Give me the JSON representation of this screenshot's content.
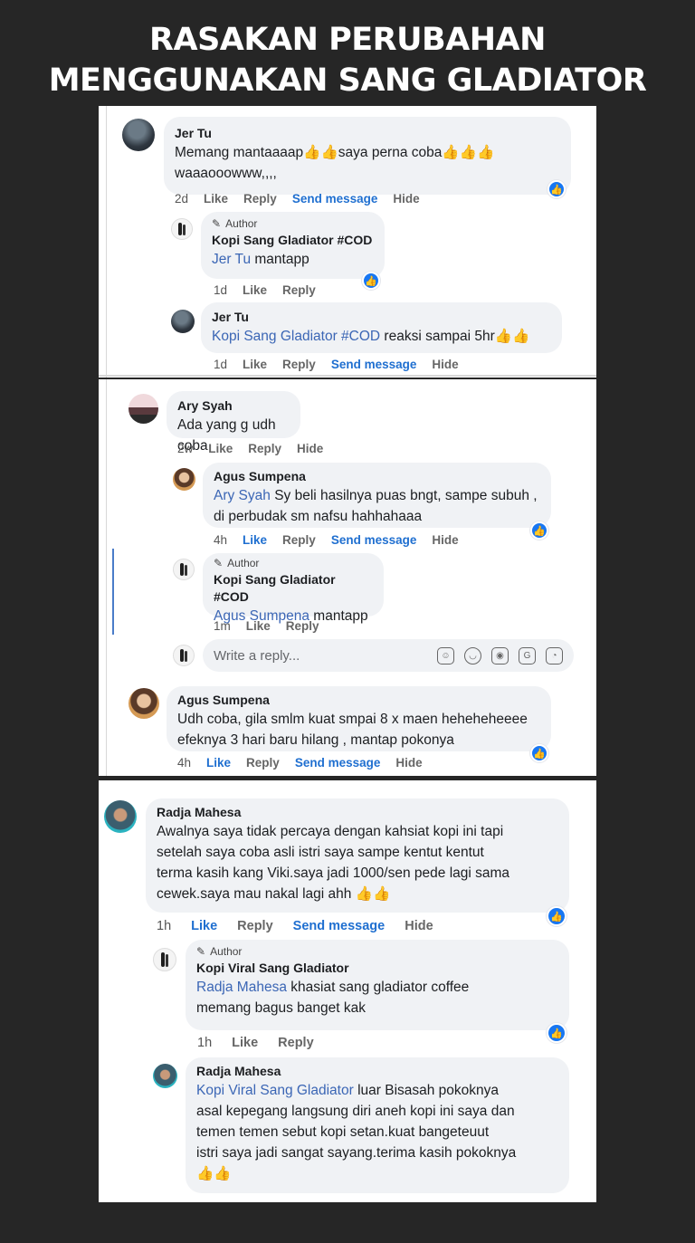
{
  "headline": {
    "line1": "RASAKAN PERUBAHAN",
    "line2": "MENGGUNAKAN SANG GLADIATOR"
  },
  "icons": {
    "like": "thumbs-up-icon",
    "author": "pencil-icon"
  },
  "colors": {
    "background": "#262626",
    "like_badge": "#1877f2",
    "mention": "#3b66b5",
    "active_link": "#1f6fd0"
  },
  "labels": {
    "like": "Like",
    "reply": "Reply",
    "send_message": "Send message",
    "hide": "Hide",
    "author": "Author",
    "thumbs": "👍👍"
  },
  "panel1": {
    "c1": {
      "name": "Jer Tu",
      "text1": "Memang mantaaaap👍👍saya perna coba👍👍👍",
      "text2": "waaaooowww,,,,",
      "time": "2d"
    },
    "r1": {
      "name": "Kopi Sang Gladiator #COD",
      "mention": "Jer Tu",
      "text": " mantapp",
      "time": "1d"
    },
    "r2": {
      "name": "Jer Tu",
      "mention": "Kopi Sang Gladiator #COD",
      "text": " reaksi sampai 5hr👍👍",
      "time": "1d"
    }
  },
  "panel2": {
    "c1": {
      "name": "Ary Syah",
      "text": "Ada yang g udh coba",
      "time": "2w"
    },
    "r1": {
      "name": "Agus Sumpena",
      "mention": "Ary Syah",
      "text1": " Sy beli hasilnya puas bngt, sampe subuh ,",
      "text2": "di perbudak sm nafsu hahhahaaa",
      "time": "4h"
    },
    "r2": {
      "name": "Kopi Sang Gladiator #COD",
      "mention": "Agus Sumpena",
      "text": " mantapp",
      "time": "1m"
    },
    "reply_placeholder": "Write a reply...",
    "c2": {
      "name": "Agus Sumpena",
      "text1": "Udh coba, gila smlm kuat smpai 8 x maen heheheheeee",
      "text2": "efeknya 3 hari baru hilang , mantap pokonya",
      "time": "4h"
    }
  },
  "panel3": {
    "c1": {
      "name": "Radja Mahesa",
      "text1": "Awalnya saya tidak percaya dengan kahsiat kopi ini tapi",
      "text2": "setelah saya coba asli istri saya sampe kentut kentut",
      "text3": "terma kasih kang Viki.saya jadi 1000/sen pede lagi sama",
      "text4": "cewek.saya mau nakal lagi ahh 👍👍",
      "time": "1h"
    },
    "r1": {
      "name": "Kopi Viral Sang Gladiator",
      "mention": "Radja Mahesa",
      "text1": " khasiat sang gladiator coffee",
      "text2": "memang bagus banget kak",
      "time": "1h"
    },
    "r2": {
      "name": "Radja Mahesa",
      "mention": "Kopi Viral Sang Gladiator",
      "text1": " luar Bisasah pokoknya",
      "text2": "asal kepegang langsung diri aneh kopi ini saya dan",
      "text3": "temen temen sebut kopi setan.kuat bangeteuut",
      "text4": "istri saya jadi sangat sayang.terima kasih pokoknya",
      "text5": "👍👍"
    }
  }
}
